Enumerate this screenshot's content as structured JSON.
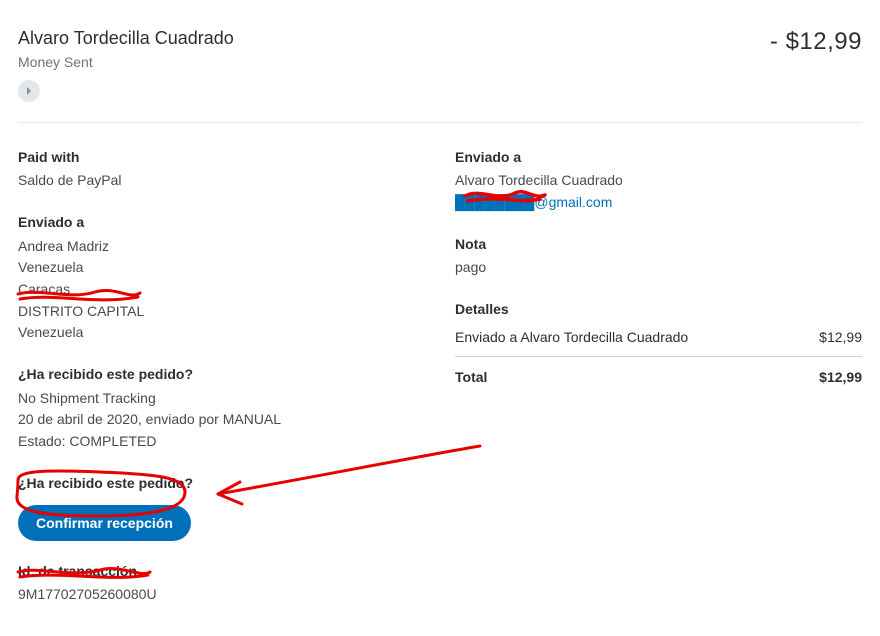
{
  "header": {
    "name": "Alvaro Tordecilla Cuadrado",
    "subline": "Money Sent",
    "amount": "- $12,99"
  },
  "left": {
    "paid_with_h": "Paid with",
    "paid_with_v": "Saldo de PayPal",
    "ship_to_h": "Enviado a",
    "addr1": "Andrea Madriz",
    "addr2": "Venezuela",
    "addr3": "Caracas",
    "addr4": "DISTRITO CAPITAL",
    "addr5": "Venezuela",
    "received_h": "¿Ha recibido este pedido?",
    "track1": "No Shipment Tracking",
    "track2": "20 de abril de 2020, enviado por MANUAL",
    "track3": "Estado: COMPLETED",
    "received_h2": "¿Ha recibido este pedido?",
    "confirm_btn": "Confirmar recepción",
    "txn_h": "Id. de transacción",
    "txn_v": "9M17702705260080U"
  },
  "right": {
    "sent_to_h": "Enviado a",
    "sent_to_name": "Alvaro Tordecilla Cuadrado",
    "email_redacted": "████████",
    "email_suffix": "@gmail.com",
    "note_h": "Nota",
    "note_v": "pago",
    "details_h": "Detalles",
    "details_line": "Enviado a Alvaro Tordecilla Cuadrado",
    "details_amt": "$12,99",
    "total_h": "Total",
    "total_amt": "$12,99"
  }
}
